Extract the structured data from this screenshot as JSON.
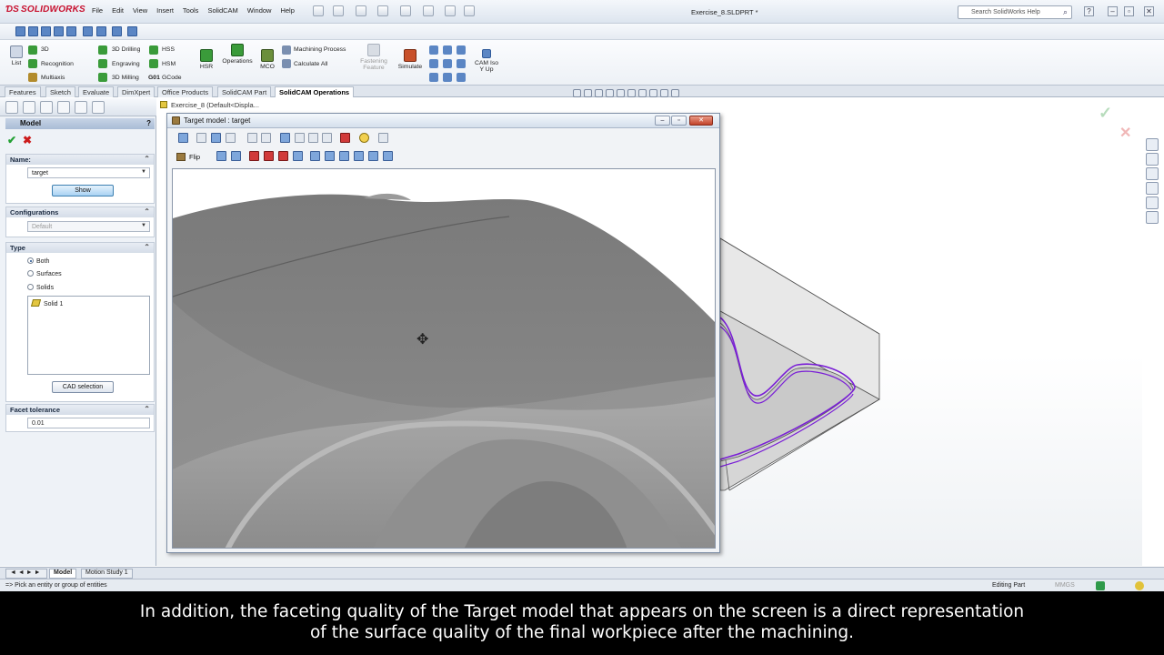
{
  "app": {
    "logo": "SOLIDWORKS",
    "document_title": "Exercise_8.SLDPRT *"
  },
  "menu": [
    "File",
    "Edit",
    "View",
    "Insert",
    "Tools",
    "SolidCAM",
    "Window",
    "Help"
  ],
  "search": {
    "placeholder": "Search SolidWorks Help"
  },
  "command_manager": {
    "list": "List",
    "col1": [
      "3D",
      "Recognition",
      "Multiaxis"
    ],
    "col2": [
      "3D Drilling",
      "Engraving",
      "3D Milling"
    ],
    "col3": [
      "HSS",
      "HSM",
      "GCode"
    ],
    "gcode_prefix": "G01",
    "hsr": "HSR",
    "operations": "Operations",
    "mco": "MCO",
    "col4": [
      "Machining Process",
      "Calculate All"
    ],
    "fastening_feature": [
      "Fastening",
      "Feature"
    ],
    "simulate": "Simulate",
    "cam_iso": [
      "CAM Iso",
      "Y Up"
    ]
  },
  "tabs": [
    "Features",
    "Sketch",
    "Evaluate",
    "DimXpert",
    "Office Products",
    "SolidCAM Part",
    "SolidCAM Operations"
  ],
  "active_tab": "SolidCAM Operations",
  "property_manager": {
    "title": "Model",
    "help": "?",
    "name_group": {
      "label": "Name:",
      "value": "target",
      "show_button": "Show"
    },
    "configurations_group": {
      "label": "Configurations",
      "value": "Default"
    },
    "type_group": {
      "label": "Type",
      "options": [
        "Both",
        "Surfaces",
        "Solids"
      ],
      "selected": "Both",
      "list_item": "Solid 1",
      "cad_selection_button": "CAD selection"
    },
    "facet_group": {
      "label": "Facet tolerance",
      "value": "0.01"
    }
  },
  "feature_tree_crumb": "Exercise_8  (Default<Displa...",
  "target_window": {
    "title": "Target model : target",
    "flip_label": "Flip"
  },
  "bottom_tabs": [
    "Model",
    "Motion Study 1"
  ],
  "status": {
    "left": "=> Pick an entity or group of entities",
    "mode": "Editing Part",
    "units": "MMGS"
  },
  "caption": {
    "line1": "In addition, the faceting quality of the Target model that appears on the screen is a direct representation",
    "line2": "of the surface quality of the final workpiece after the machining."
  },
  "colors": {
    "toolpath": "#7a1fd6",
    "accept": "#22a033",
    "cancel": "#cc1b1b",
    "logo": "#c8102e"
  }
}
